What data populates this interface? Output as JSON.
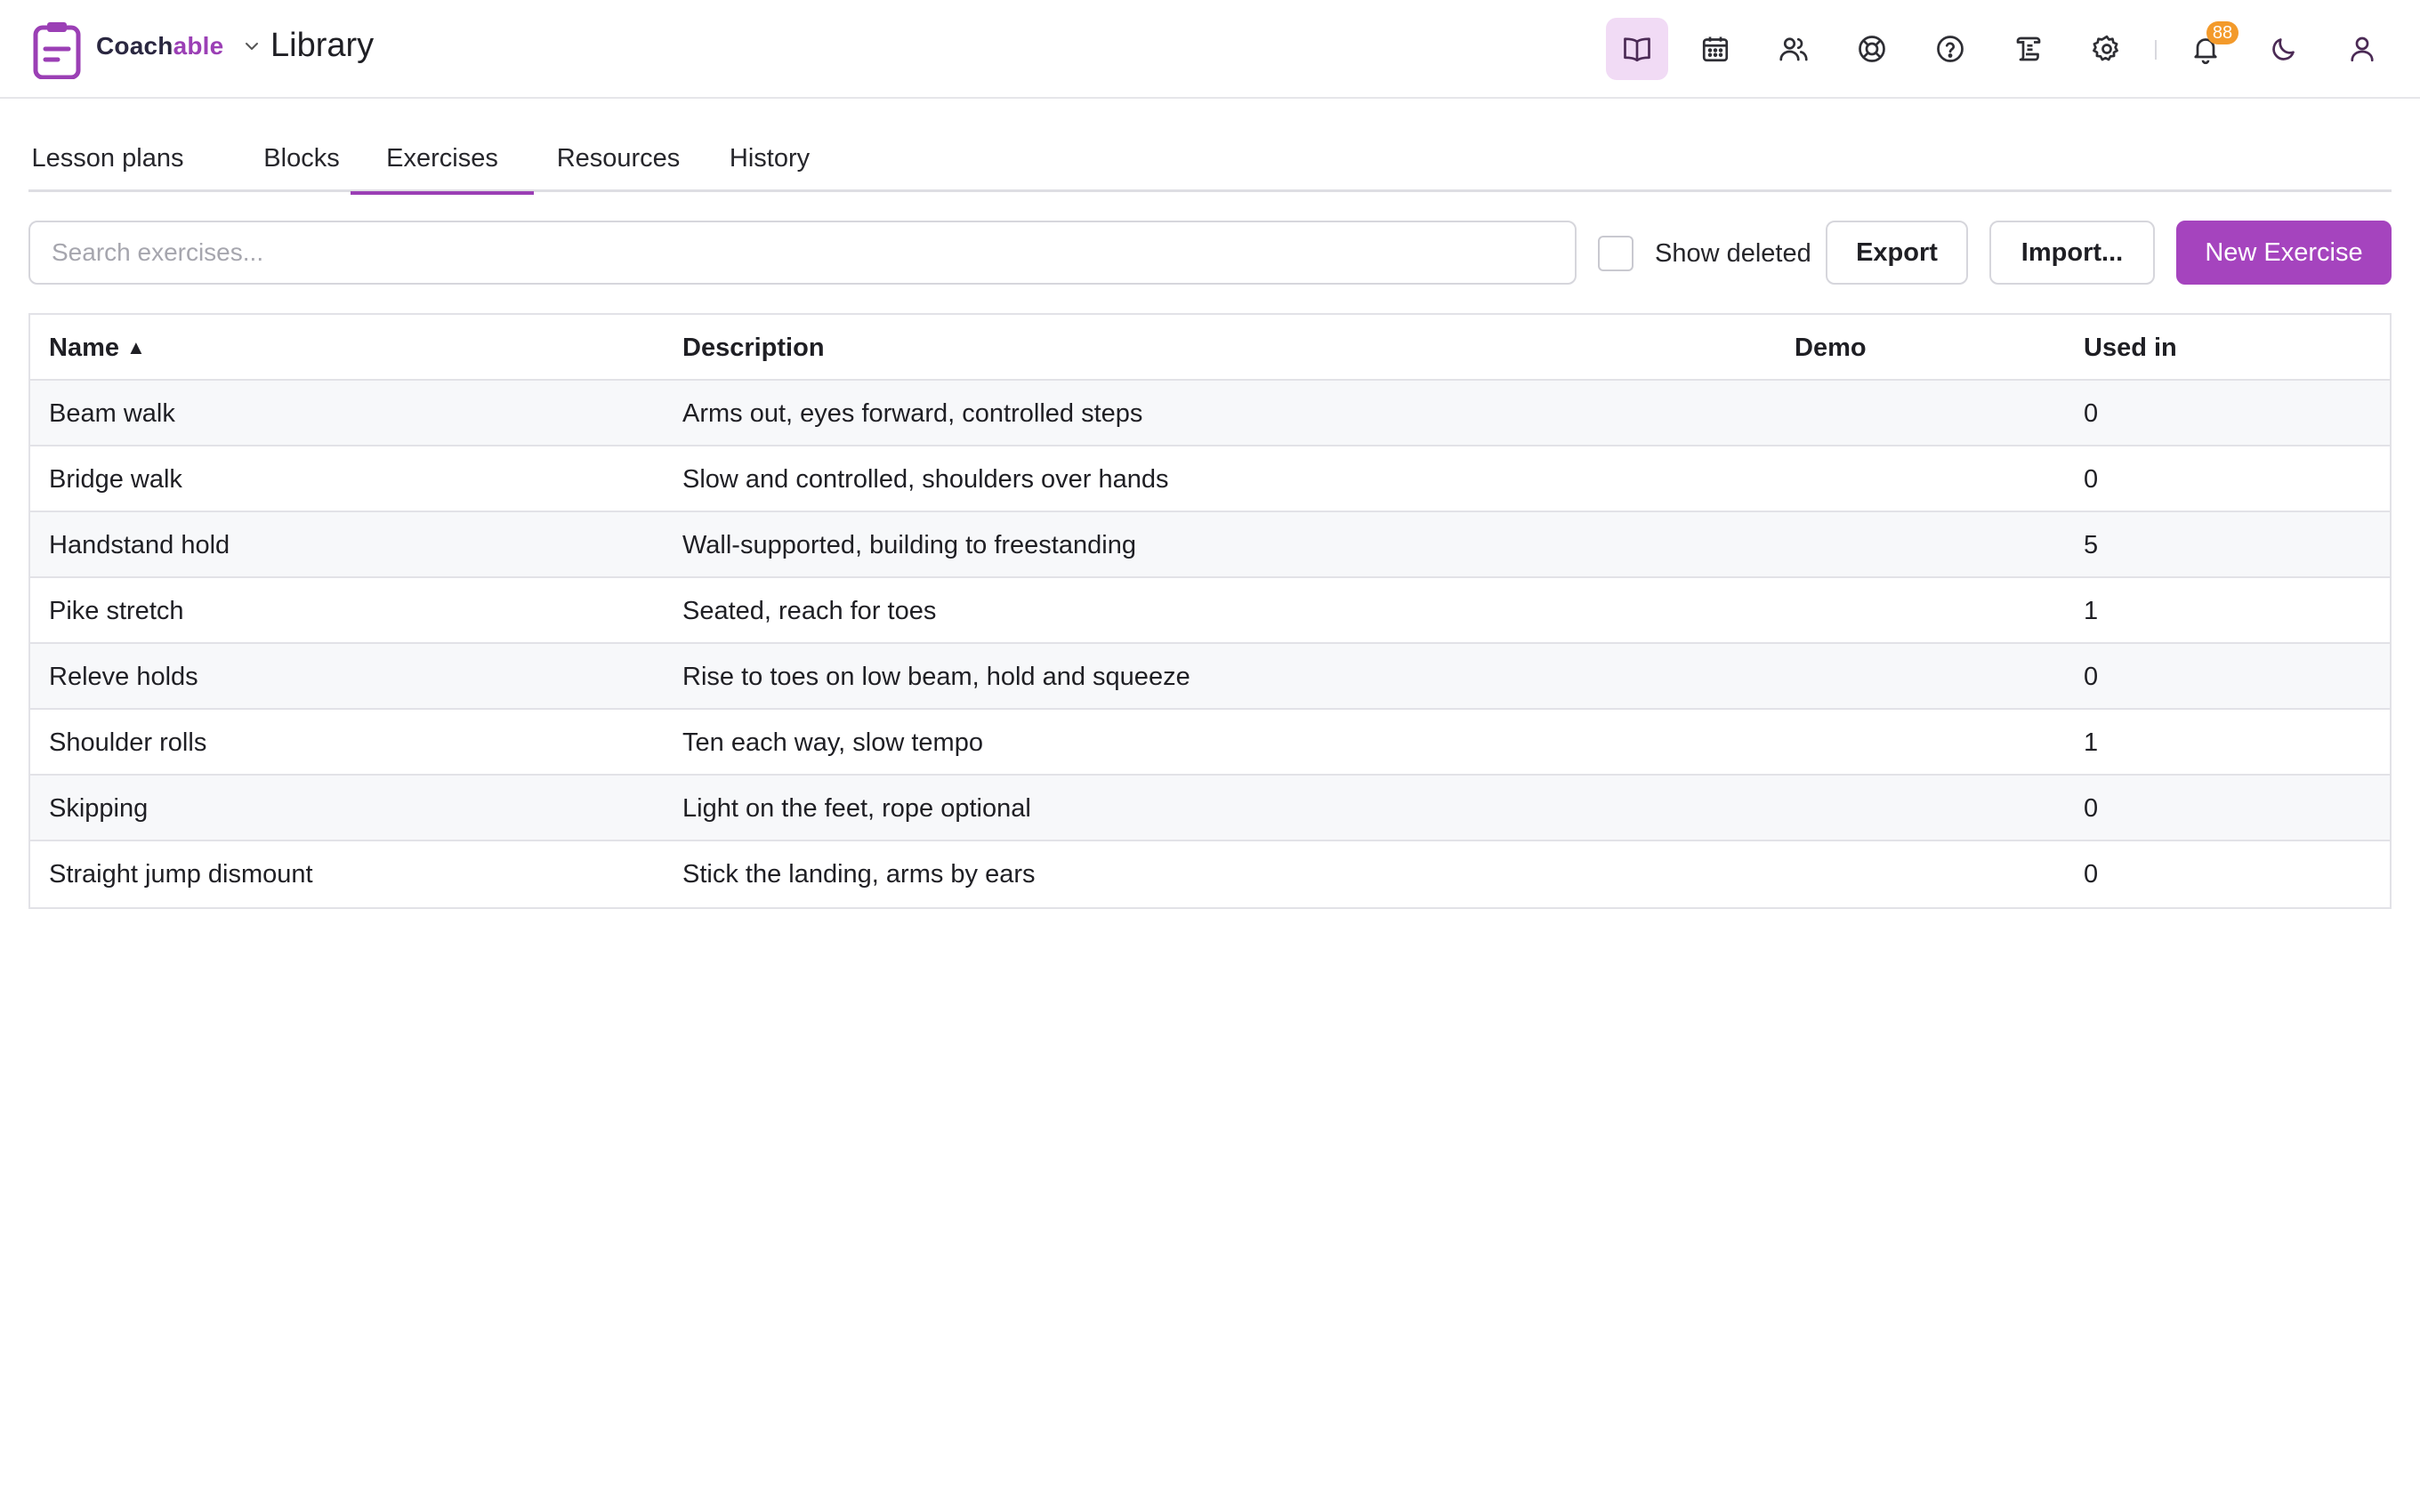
{
  "header": {
    "brand_part1": "Coach",
    "brand_part2": "able",
    "title": "Library",
    "accent_color": "#9b3fb5",
    "icons": [
      {
        "name": "library-icon",
        "active": true
      },
      {
        "name": "calendar-icon",
        "active": false
      },
      {
        "name": "users-icon",
        "active": false
      },
      {
        "name": "support-icon",
        "active": false
      },
      {
        "name": "help-icon",
        "active": false
      },
      {
        "name": "scroll-icon",
        "active": false
      },
      {
        "name": "settings-icon",
        "active": false
      },
      {
        "name": "bell-icon",
        "active": false
      },
      {
        "name": "moon-icon",
        "active": false
      },
      {
        "name": "user-icon",
        "active": false
      }
    ],
    "notification_count": "88"
  },
  "tabs": [
    {
      "label": "Lesson plans",
      "active": false
    },
    {
      "label": "Blocks",
      "active": false
    },
    {
      "label": "Exercises",
      "active": true
    },
    {
      "label": "Resources",
      "active": false
    },
    {
      "label": "History",
      "active": false
    }
  ],
  "toolbar": {
    "search_placeholder": "Search exercises...",
    "search_value": "",
    "show_deleted_label": "Show deleted",
    "show_deleted_checked": false,
    "export_label": "Export",
    "import_label": "Import...",
    "new_label": "New Exercise"
  },
  "table": {
    "columns": {
      "name": "Name",
      "name_sort": "▲",
      "description": "Description",
      "demo": "Demo",
      "used_in": "Used in"
    },
    "rows": [
      {
        "name": "Beam walk",
        "description": "Arms out, eyes forward, controlled steps",
        "demo": "",
        "used_in": "0"
      },
      {
        "name": "Bridge walk",
        "description": "Slow and controlled, shoulders over hands",
        "demo": "",
        "used_in": "0"
      },
      {
        "name": "Handstand hold",
        "description": "Wall-supported, building to freestanding",
        "demo": "",
        "used_in": "5"
      },
      {
        "name": "Pike stretch",
        "description": "Seated, reach for toes",
        "demo": "",
        "used_in": "1"
      },
      {
        "name": "Releve holds",
        "description": "Rise to toes on low beam, hold and squeeze",
        "demo": "",
        "used_in": "0"
      },
      {
        "name": "Shoulder rolls",
        "description": "Ten each way, slow tempo",
        "demo": "",
        "used_in": "1"
      },
      {
        "name": "Skipping",
        "description": "Light on the feet, rope optional",
        "demo": "",
        "used_in": "0"
      },
      {
        "name": "Straight jump dismount",
        "description": "Stick the landing, arms by ears",
        "demo": "",
        "used_in": "0"
      }
    ]
  }
}
